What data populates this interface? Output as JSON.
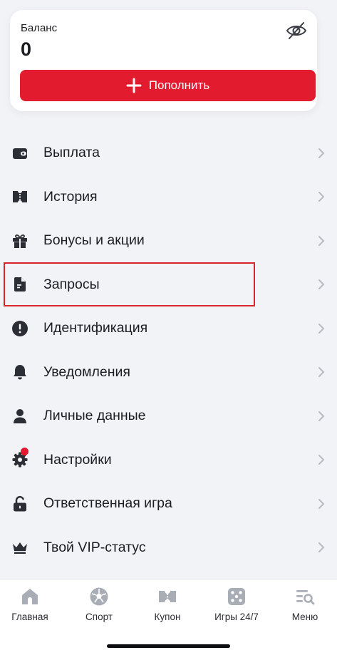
{
  "balance": {
    "label": "Баланс",
    "value": "0",
    "topup_label": "Пополнить",
    "hide_icon": "eye-off-icon"
  },
  "menu": {
    "items": [
      {
        "label": "Выплата",
        "icon": "wallet-icon"
      },
      {
        "label": "История",
        "icon": "ticket-icon"
      },
      {
        "label": "Бонусы и акции",
        "icon": "gift-icon"
      },
      {
        "label": "Запросы",
        "icon": "document-icon",
        "highlighted": true
      },
      {
        "label": "Идентификация",
        "icon": "alert-circle-icon"
      },
      {
        "label": "Уведомления",
        "icon": "bell-icon"
      },
      {
        "label": "Личные данные",
        "icon": "user-icon"
      },
      {
        "label": "Настройки",
        "icon": "gear-icon",
        "badge": true
      },
      {
        "label": "Ответственная игра",
        "icon": "unlock-icon"
      },
      {
        "label": "Твой VIP-статус",
        "icon": "crown-icon"
      }
    ]
  },
  "tabbar": {
    "tabs": [
      {
        "label": "Главная",
        "icon": "home-icon"
      },
      {
        "label": "Спорт",
        "icon": "soccer-ball-icon"
      },
      {
        "label": "Купон",
        "icon": "coupon-icon"
      },
      {
        "label": "Игры 24/7",
        "icon": "dice-icon"
      },
      {
        "label": "Меню",
        "icon": "menu-search-icon"
      }
    ]
  },
  "colors": {
    "accent": "#e21b2f",
    "background": "#f2f3f7",
    "icon": "#2b2e35",
    "tab_icon": "#a9adb6"
  }
}
